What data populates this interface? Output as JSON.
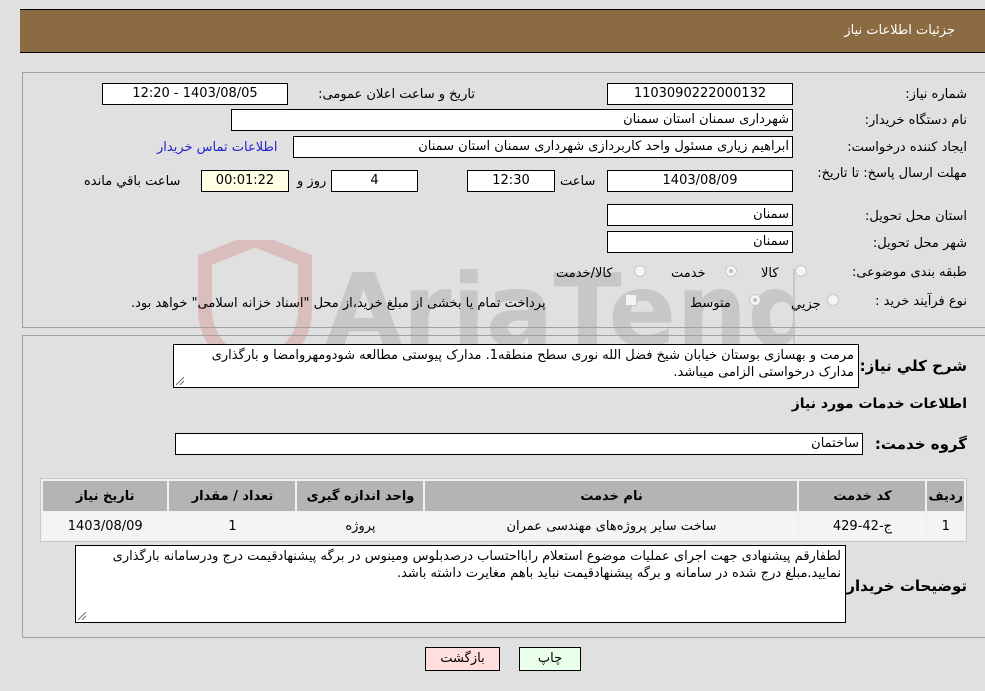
{
  "header": {
    "title": "جزئیات اطلاعات نیاز"
  },
  "form": {
    "need_number": {
      "label": "شماره نیاز:",
      "value": "1103090222000132"
    },
    "announce_datetime": {
      "label": "تاریخ و ساعت اعلان عمومی:",
      "value": "1403/08/05 - 12:20"
    },
    "buyer_org": {
      "label": "نام دستگاه خریدار:",
      "value": "شهرداری سمنان استان سمنان"
    },
    "requester": {
      "label": "ایجاد کننده درخواست:",
      "value": "ابراهیم زیاری مسئول واحد کاربردازی شهرداری سمنان استان سمنان"
    },
    "buyer_contact_link": "اطلاعات تماس خریدار",
    "deadline": {
      "label": "مهلت ارسال پاسخ: تا تاریخ:",
      "date": "1403/08/09",
      "time_label": "ساعت",
      "time": "12:30",
      "days": "4",
      "days_label": "روز و",
      "remaining": "00:01:22",
      "remaining_label": "ساعت باقي مانده"
    },
    "delivery_province": {
      "label": "استان محل تحویل:",
      "value": "سمنان"
    },
    "delivery_city": {
      "label": "شهر محل تحویل:",
      "value": "سمنان"
    },
    "category": {
      "label": "طبقه بندی موضوعی:",
      "options": [
        "کالا",
        "خدمت",
        "کالا/خدمت"
      ],
      "selected": "خدمت"
    },
    "purchase_type": {
      "label": "نوع فرآیند خرید :",
      "options": [
        "جزیي",
        "متوسط"
      ],
      "selected": "متوسط",
      "treasury_note": "پرداخت تمام یا بخشی از مبلغ خرید،از محل \"اسناد خزانه اسلامی\" خواهد بود."
    }
  },
  "description": {
    "label": "شرح کلي نیاز:",
    "value": "مرمت و بهسازی بوستان خیابان شیخ فضل الله نوری سطح منطقه1. مدارک پیوستی مطالعه شودومهروامضا و بارگذاری مدارک درخواستی الزامی میباشد."
  },
  "services": {
    "section_title": "اطلاعات خدمات مورد نیاز",
    "group_label": "گروه خدمت:",
    "group_value": "ساختمان",
    "table": {
      "headers": [
        "ردیف",
        "کد خدمت",
        "نام خدمت",
        "واحد اندازه گیری",
        "تعداد / مقدار",
        "تاریخ نیاز"
      ],
      "rows": [
        [
          "1",
          "ج-42-429",
          "ساخت سایر پروژه‌های مهندسی عمران",
          "پروژه",
          "1",
          "1403/08/09"
        ]
      ]
    }
  },
  "buyer_notes": {
    "label": "توضیحات خریدار:",
    "value": "لطفارقم پیشنهادی جهت اجرای عملیات موضوع استعلام رابااحتساب درصدبلوس ومینوس در برگه پیشنهادقیمت درج ودرسامانه بارگذاری نمایید.مبلغ درج شده در سامانه و برگه پیشنهادقیمت نباید باهم مغایرت داشته باشد."
  },
  "buttons": {
    "print": "چاپ",
    "back": "بازگشت"
  },
  "watermark": {
    "text": "AriaTender.neT"
  }
}
